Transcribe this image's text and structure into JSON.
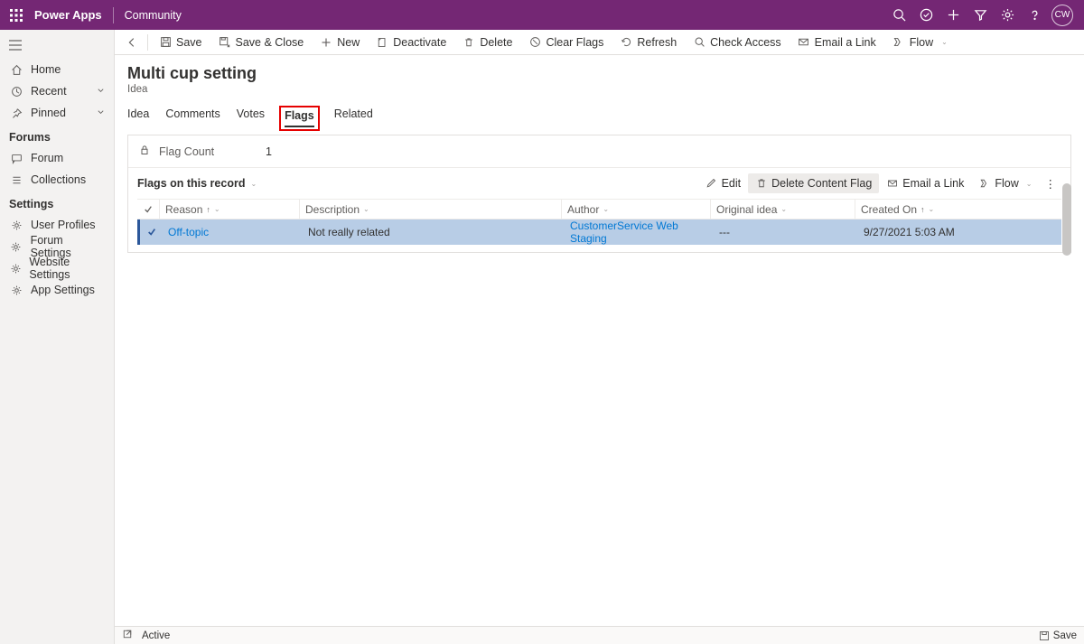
{
  "topbar": {
    "app_name": "Power Apps",
    "area": "Community",
    "avatar_initials": "CW"
  },
  "leftnav": {
    "items_main": [
      {
        "label": "Home",
        "icon": "home"
      },
      {
        "label": "Recent",
        "icon": "clock",
        "expandable": true
      },
      {
        "label": "Pinned",
        "icon": "pin",
        "expandable": true
      }
    ],
    "sections": [
      {
        "heading": "Forums",
        "items": [
          {
            "label": "Forum",
            "icon": "chat"
          },
          {
            "label": "Collections",
            "icon": "list"
          }
        ]
      },
      {
        "heading": "Settings",
        "items": [
          {
            "label": "User Profiles",
            "icon": "gear"
          },
          {
            "label": "Forum Settings",
            "icon": "gear"
          },
          {
            "label": "Website Settings",
            "icon": "gear"
          },
          {
            "label": "App Settings",
            "icon": "gear"
          }
        ]
      }
    ]
  },
  "commands": {
    "save": "Save",
    "save_close": "Save & Close",
    "new": "New",
    "deactivate": "Deactivate",
    "delete": "Delete",
    "clear_flags": "Clear Flags",
    "refresh": "Refresh",
    "check_access": "Check Access",
    "email_link": "Email a Link",
    "flow": "Flow"
  },
  "page": {
    "title": "Multi cup setting",
    "entity": "Idea"
  },
  "tabs": [
    "Idea",
    "Comments",
    "Votes",
    "Flags",
    "Related"
  ],
  "active_tab": "Flags",
  "flag_count": {
    "label": "Flag Count",
    "value": "1"
  },
  "subgrid": {
    "title": "Flags on this record",
    "buttons": {
      "edit": "Edit",
      "delete_content_flag": "Delete Content Flag",
      "email_link": "Email a Link",
      "flow": "Flow"
    },
    "columns": {
      "reason": "Reason",
      "description": "Description",
      "author": "Author",
      "original_idea": "Original idea",
      "created_on": "Created On"
    },
    "rows": [
      {
        "reason": "Off-topic",
        "description": "Not really related",
        "author": "CustomerService Web Staging",
        "original_idea": "---",
        "created_on": "9/27/2021 5:03 AM"
      }
    ]
  },
  "footer": {
    "status": "Active",
    "save": "Save"
  }
}
